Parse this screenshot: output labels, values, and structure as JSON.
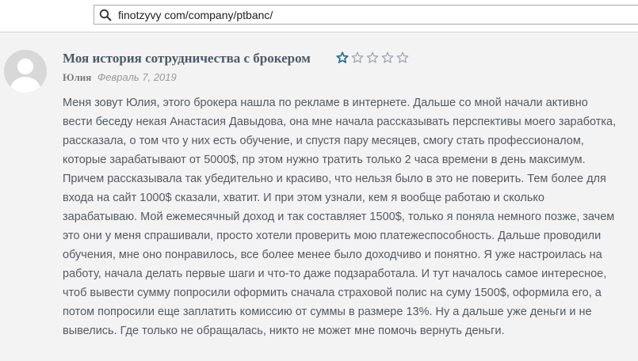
{
  "browser": {
    "url": "finotzyvy com/company/ptbanc/"
  },
  "review": {
    "title": "Моя история сотрудничества с брокером",
    "rating": 1,
    "rating_max": 5,
    "author": "Юлия",
    "date": "Февраль 7, 2019",
    "body_lines": [
      "Меня зовут Юлия, этого брокера нашла по рекламе в интернете. Дальше со мной начали активно",
      "вести беседу некая Анастасия Давыдова, она мне начала рассказывать перспективы моего заработка,",
      "рассказала, о том что у них есть обучение, и спустя пару месяцев, смогу стать профессионалом,",
      "которые зарабатывают от 5000$, пр этом нужно тратить только 2 часа времени в день максимум.",
      "Причем рассказывала так убедительно и красиво, что нельзя было в это не поверить. Тем более для",
      "входа на сайт 1000$ сказали, хватит. И при этом узнали, кем я вообще работаю и сколько",
      "зарабатываю. Мой ежемесячный доход и так составляет 1500$, только я поняла немного позже, зачем",
      "это они у меня спрашивали, просто хотели проверить мою платежеспособность. Дальше проводили",
      "обучения, мне оно понравилось, все более менее было доходчиво и понятно. Я уже настроилась на",
      "работу, начала делать первые шаги и что-то даже подзаработала. И тут началось самое интересное,",
      "чтоб вывести сумму попросили оформить сначала страховой полис на суму 1500$, оформила его, а",
      "потом попросили еще заплатить комиссию от суммы в размере 13%. Ну а дальше уже деньги и не",
      "вывелись. Где только не обращалась, никто не может мне помочь вернуть деньги."
    ]
  },
  "icons": {
    "search": "search-icon",
    "avatar": "user-avatar-placeholder",
    "star": "star-icon"
  },
  "colors": {
    "star_filled": "#2f6f95",
    "star_empty": "#9aa4ab",
    "title": "#4a5a66",
    "text": "#555a5f"
  }
}
